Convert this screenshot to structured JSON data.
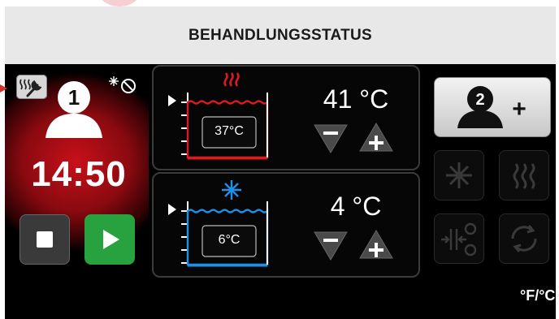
{
  "header": {
    "title": "BEHANDLUNGSSTATUS"
  },
  "left": {
    "tool_icon": "heater-wrench-icon",
    "user_number": "1",
    "snow_off_icon": "snowflake-off-icon",
    "timer": "14:50",
    "stop_icon": "stop-icon",
    "play_icon": "play-icon",
    "play_color": "#27a23f"
  },
  "baths": [
    {
      "name": "warm",
      "icon": "heat-waves-icon",
      "icon_color": "#e0191e",
      "current": "37°C",
      "set": "41 °C",
      "frame_color": "#e0191e"
    },
    {
      "name": "cold",
      "icon": "snowflake-icon",
      "icon_color": "#1e90e8",
      "current": "6°C",
      "set": "4 °C",
      "frame_color": "#1e90e8"
    }
  ],
  "right": {
    "user2_number": "2",
    "user2_plus": "+",
    "unit_toggle": {
      "f": "°F",
      "c": "/°C"
    }
  }
}
